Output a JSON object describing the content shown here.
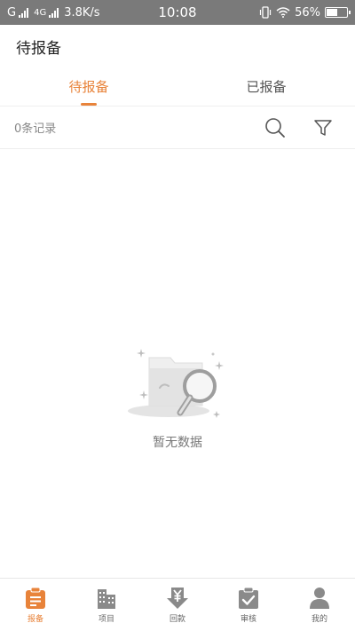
{
  "status_bar": {
    "carrier": "G",
    "network": "4G",
    "speed": "3.8K/s",
    "time": "10:08",
    "battery": "56%",
    "battery_level": 0.56
  },
  "header": {
    "title": "待报备"
  },
  "tabs": [
    {
      "label": "待报备",
      "active": true
    },
    {
      "label": "已报备",
      "active": false
    }
  ],
  "filter_bar": {
    "record_count": "0条记录",
    "search_icon": "search-icon",
    "filter_icon": "filter-icon"
  },
  "empty_state": {
    "text": "暂无数据",
    "icon": "empty-folder-magnifier-icon"
  },
  "bottom_nav": [
    {
      "label": "报备",
      "icon": "report-clipboard-icon",
      "active": true
    },
    {
      "label": "项目",
      "icon": "building-icon",
      "active": false
    },
    {
      "label": "回款",
      "icon": "yuan-download-icon",
      "active": false
    },
    {
      "label": "审核",
      "icon": "check-clipboard-icon",
      "active": false
    },
    {
      "label": "我的",
      "icon": "user-icon",
      "active": false
    }
  ],
  "colors": {
    "accent": "#e8833a",
    "status_bar_bg": "#7a7a7a",
    "inactive_icon": "#8a8a8a"
  }
}
